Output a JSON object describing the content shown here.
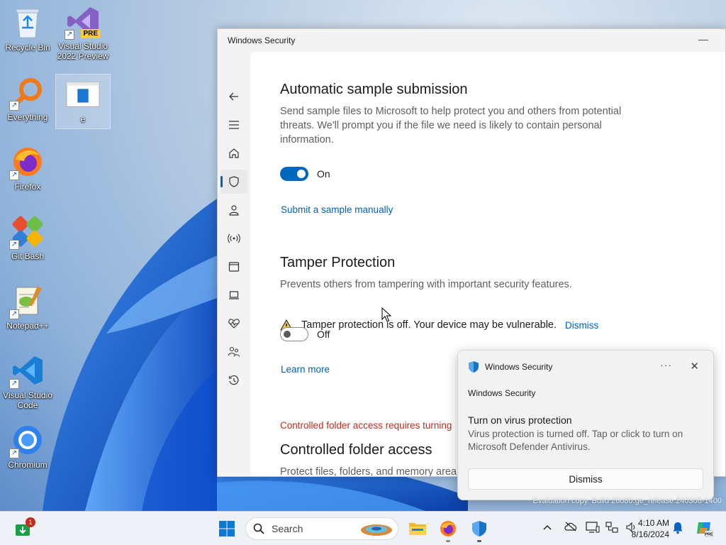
{
  "desktop": {
    "icons": [
      {
        "label": "Recycle Bin",
        "icon": "recycle-bin-icon"
      },
      {
        "label": "Visual Studio 2022 Preview",
        "icon": "visual-studio-icon",
        "badge": "PRE"
      },
      {
        "label": "Everything",
        "icon": "everything-icon"
      },
      {
        "label": "e",
        "icon": "window-file-icon"
      },
      {
        "label": "Firefox",
        "icon": "firefox-icon"
      },
      {
        "label": "Git Bash",
        "icon": "git-bash-icon"
      },
      {
        "label": "Notepad++",
        "icon": "notepadpp-icon"
      },
      {
        "label": "Visual Studio Code",
        "icon": "vscode-icon"
      },
      {
        "label": "Chromium",
        "icon": "chromium-icon"
      }
    ],
    "watermark": "Evaluation copy. Build 26080.ge_release.240308-1400"
  },
  "window": {
    "title": "Windows Security",
    "minimize_glyph": "—",
    "nav": [
      "back-icon",
      "menu-icon",
      "home-icon",
      "shield-icon",
      "account-icon",
      "network-icon",
      "app-browser-icon",
      "device-security-icon",
      "health-icon",
      "family-icon",
      "history-icon",
      "settings-icon"
    ],
    "sections": {
      "auto_sample": {
        "heading": "Automatic sample submission",
        "description": "Send sample files to Microsoft to help protect you and others from potential threats. We'll prompt you if the file we need is likely to contain personal information.",
        "toggle_state": "On",
        "link": "Submit a sample manually"
      },
      "tamper": {
        "heading": "Tamper Protection",
        "description": "Prevents others from tampering with important security features.",
        "warning": "Tamper protection is off. Your device may be vulnerable.",
        "dismiss": "Dismiss",
        "toggle_state": "Off",
        "link": "Learn more"
      },
      "cfa": {
        "warning": "Controlled folder access requires turning",
        "heading": "Controlled folder access",
        "description": "Protect files, folders, and memory area"
      }
    }
  },
  "toast": {
    "app_name": "Windows Security",
    "more_glyph": "···",
    "close_glyph": "✕",
    "subtitle": "Windows Security",
    "title": "Turn on virus protection",
    "body": "Virus protection is turned off. Tap or click to turn on Microsoft Defender Antivirus.",
    "button": "Dismiss"
  },
  "taskbar": {
    "search_placeholder": "Search",
    "notification_badge": "1",
    "time": "4:10 AM",
    "date": "8/16/2024"
  },
  "colors": {
    "accent": "#005fb8",
    "toggle_on": "#0067c0",
    "error_red": "#c42b1c",
    "warning_yellow": "#f2c94c"
  }
}
